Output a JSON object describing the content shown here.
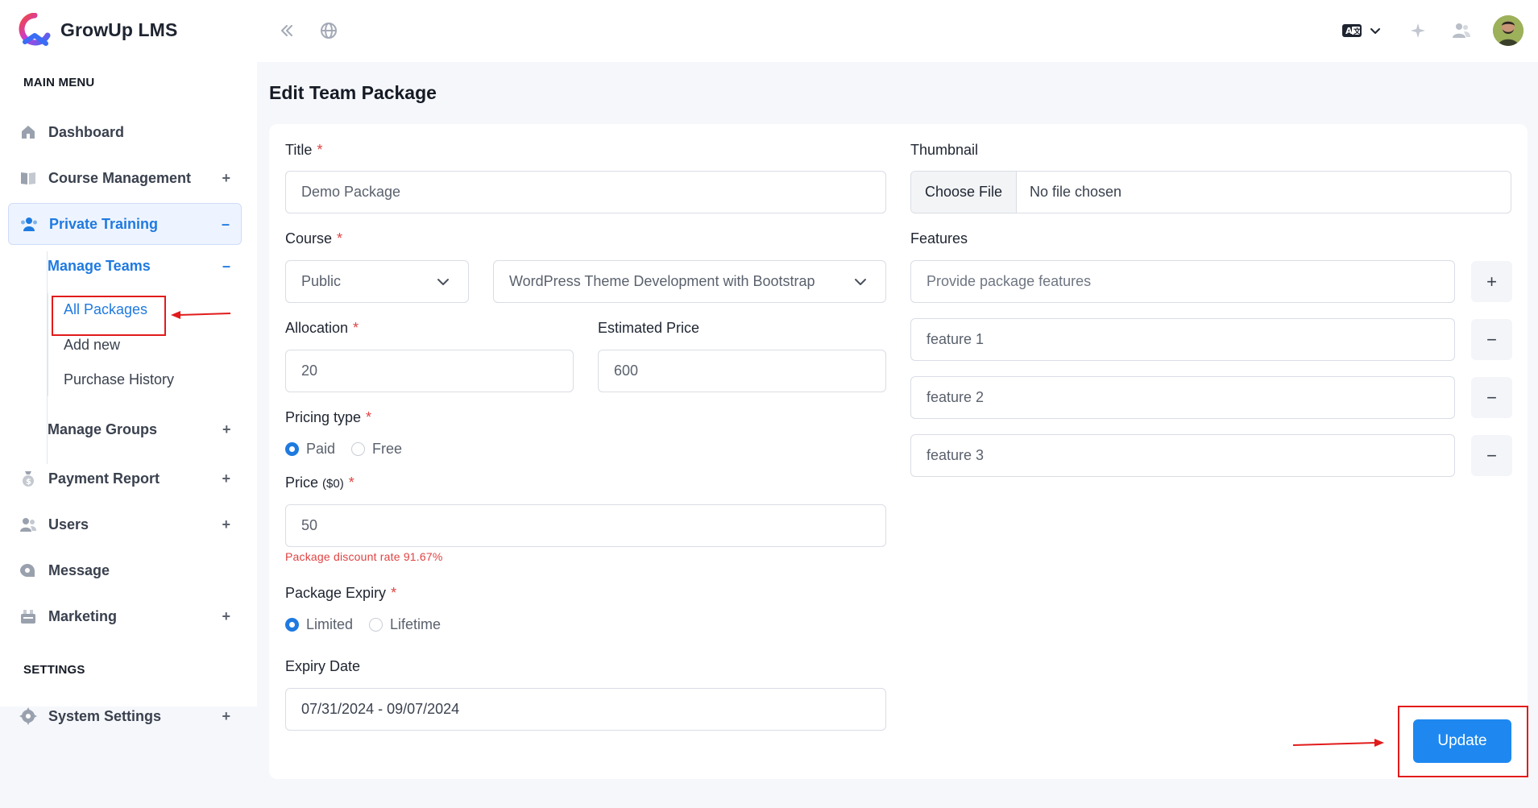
{
  "app": {
    "name": "GrowUp LMS"
  },
  "sidebar": {
    "main_menu_label": "MAIN MENU",
    "settings_label": "SETTINGS",
    "items": [
      {
        "label": "Dashboard",
        "icon": "home-icon"
      },
      {
        "label": "Course Management",
        "icon": "book-icon",
        "toggle": "+"
      },
      {
        "label": "Private Training",
        "icon": "users-icon",
        "toggle": "–"
      },
      {
        "label": "Payment Report",
        "icon": "money-bag-icon",
        "toggle": "+"
      },
      {
        "label": "Users",
        "icon": "user-group-icon",
        "toggle": "+"
      },
      {
        "label": "Message",
        "icon": "message-icon"
      },
      {
        "label": "Marketing",
        "icon": "marketing-icon",
        "toggle": "+"
      }
    ],
    "manage_teams": {
      "label": "Manage Teams",
      "toggle": "–"
    },
    "manage_groups": {
      "label": "Manage Groups",
      "toggle": "+"
    },
    "team_items": [
      "All Packages",
      "Add new",
      "Purchase History"
    ],
    "system_settings": {
      "label": "System Settings",
      "toggle": "+"
    }
  },
  "page": {
    "title": "Edit Team Package"
  },
  "form": {
    "title_label": "Title",
    "title_value": "Demo Package",
    "course_label": "Course",
    "course_type": "Public",
    "course_name": "WordPress Theme Development with Bootstrap",
    "allocation_label": "Allocation",
    "allocation_value": "20",
    "estimated_price_label": "Estimated Price",
    "estimated_price_value": "600",
    "pricing_type_label": "Pricing type",
    "pricing_options": [
      "Paid",
      "Free"
    ],
    "pricing_selected": "Paid",
    "price_label": "Price",
    "price_label_suffix": "($0)",
    "price_value": "50",
    "discount_hint": "Package discount rate 91.67%",
    "expiry_label": "Package Expiry",
    "expiry_options": [
      "Limited",
      "Lifetime"
    ],
    "expiry_selected": "Limited",
    "expiry_date_label": "Expiry Date",
    "expiry_date_value": "07/31/2024 - 09/07/2024",
    "thumbnail_label": "Thumbnail",
    "choose_file_label": "Choose File",
    "no_file_text": "No file chosen",
    "features_label": "Features",
    "features_placeholder": "Provide package features",
    "features": [
      "feature 1",
      "feature 2",
      "feature 3"
    ],
    "add_symbol": "+",
    "remove_symbol": "−",
    "update_label": "Update"
  },
  "colors": {
    "accent": "#1f7ae0",
    "button": "#1e88f0",
    "required": "#e04343",
    "annotation": "#e21b1b"
  }
}
